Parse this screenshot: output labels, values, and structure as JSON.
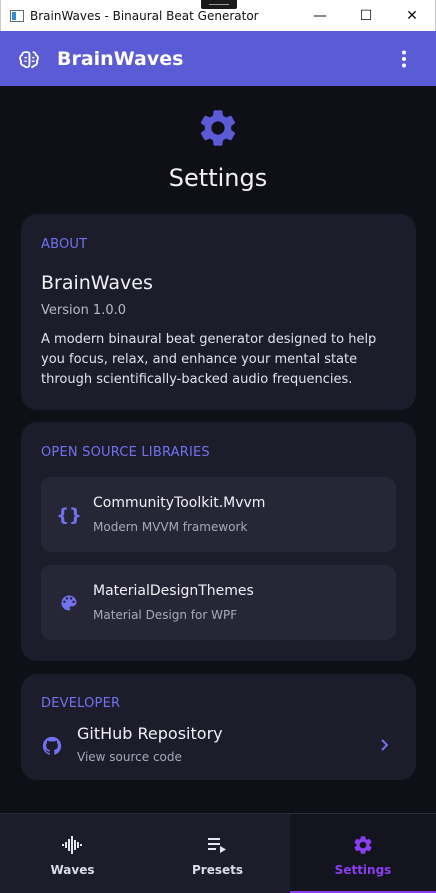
{
  "window": {
    "title": "BrainWaves - Binaural Beat Generator",
    "controls": {
      "minimize": "—",
      "maximize": "☐",
      "close": "✕"
    }
  },
  "appbar": {
    "app_name": "BrainWaves",
    "logo_icon": "brain-icon",
    "menu_icon": "more-vertical-icon",
    "color": "#5b5bd6"
  },
  "page": {
    "icon": "gear-icon",
    "title": "Settings"
  },
  "about": {
    "section_label": "ABOUT",
    "name": "BrainWaves",
    "version": "Version 1.0.0",
    "description": "A modern binaural beat generator designed to help you focus, relax, and enhance your mental state through scientifically-backed audio frequencies."
  },
  "libraries": {
    "section_label": "OPEN SOURCE LIBRARIES",
    "items": [
      {
        "icon": "code-braces-icon",
        "glyph": "{}",
        "name": "CommunityToolkit.Mvvm",
        "description": "Modern MVVM framework"
      },
      {
        "icon": "palette-icon",
        "name": "MaterialDesignThemes",
        "description": "Material Design for WPF"
      }
    ]
  },
  "developer": {
    "section_label": "DEVELOPER",
    "link_title": "GitHub Repository",
    "link_subtitle": "View source code",
    "icon": "github-icon",
    "chevron_icon": "chevron-right-icon"
  },
  "bottom_nav": {
    "items": [
      {
        "label": "Waves",
        "icon": "waveform-icon",
        "active": false
      },
      {
        "label": "Presets",
        "icon": "playlist-play-icon",
        "active": false
      },
      {
        "label": "Settings",
        "icon": "gear-icon",
        "active": true
      }
    ]
  },
  "colors": {
    "accent": "#7272f0",
    "active_nav": "#8a3ef0",
    "background": "#0f0f17",
    "card": "#1c1c2b"
  }
}
